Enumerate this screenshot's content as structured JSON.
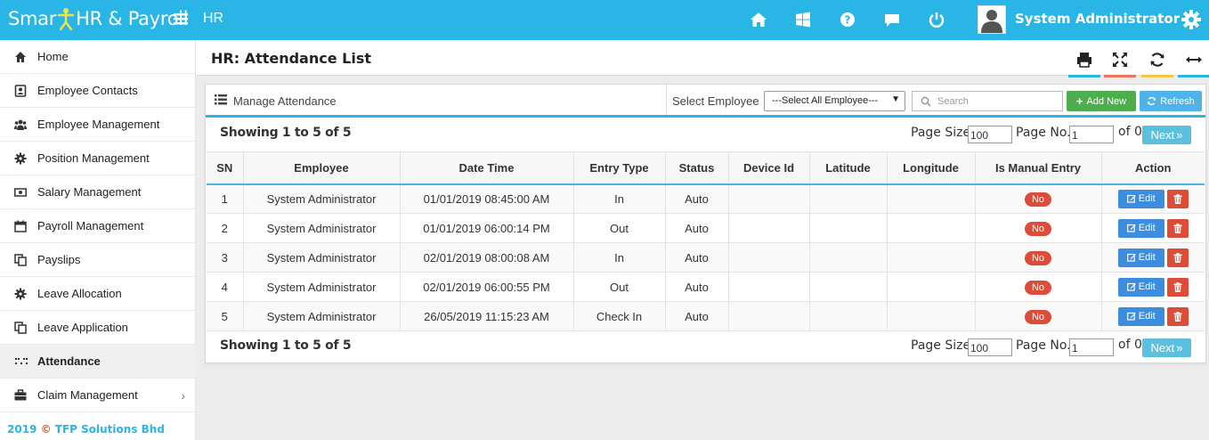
{
  "app": {
    "logo_left": "Smar",
    "logo_right": "HR & Payroll",
    "module": "HR",
    "user_name": "System Administrator",
    "brand_color": "#29b6e6",
    "top_icons": [
      "home-icon",
      "windows-icon",
      "help-icon",
      "chat-icon",
      "power-icon"
    ]
  },
  "sidebar": {
    "items": [
      {
        "label": "Home",
        "icon": "home-icon"
      },
      {
        "label": "Employee Contacts",
        "icon": "contact-icon"
      },
      {
        "label": "Employee Management",
        "icon": "users-icon"
      },
      {
        "label": "Position Management",
        "icon": "gear-icon"
      },
      {
        "label": "Salary Management",
        "icon": "money-icon"
      },
      {
        "label": "Payroll Management",
        "icon": "calendar-icon"
      },
      {
        "label": "Payslips",
        "icon": "copy-icon"
      },
      {
        "label": "Leave Allocation",
        "icon": "gear-icon"
      },
      {
        "label": "Leave Application",
        "icon": "copy-icon"
      },
      {
        "label": "Attendance",
        "icon": "fingerprint-icon"
      },
      {
        "label": "Claim Management",
        "icon": "briefcase-icon"
      }
    ],
    "footer_year": "2019",
    "footer_company": "TFP Solutions Bhd"
  },
  "page": {
    "title": "HR: Attendance List",
    "tools": [
      "print-icon",
      "fullscreen-icon",
      "refresh-icon",
      "expand-icon"
    ]
  },
  "panel": {
    "title": "Manage Attendance",
    "select_label": "Select Employee",
    "select_value": "---Select All Employee---",
    "search_placeholder": "Search",
    "add_label": "Add New",
    "refresh_label": "Refresh"
  },
  "pager": {
    "showing": "Showing 1 to 5 of 5",
    "page_size_label": "Page Size",
    "page_size": "100",
    "page_no_label": "Page No.",
    "page_no": "1",
    "of_label": "of 0",
    "next_label": "Next"
  },
  "table": {
    "columns": [
      "SN",
      "Employee",
      "Date Time",
      "Entry Type",
      "Status",
      "Device Id",
      "Latitude",
      "Longitude",
      "Is Manual Entry",
      "Action"
    ],
    "edit_label": "Edit",
    "rows": [
      {
        "sn": "1",
        "employee": "System Administrator",
        "datetime": "01/01/2019 08:45:00 AM",
        "entry": "In",
        "status": "Auto",
        "device": "",
        "lat": "",
        "lng": "",
        "manual": "No"
      },
      {
        "sn": "2",
        "employee": "System Administrator",
        "datetime": "01/01/2019 06:00:14 PM",
        "entry": "Out",
        "status": "Auto",
        "device": "",
        "lat": "",
        "lng": "",
        "manual": "No"
      },
      {
        "sn": "3",
        "employee": "System Administrator",
        "datetime": "02/01/2019 08:00:08 AM",
        "entry": "In",
        "status": "Auto",
        "device": "",
        "lat": "",
        "lng": "",
        "manual": "No"
      },
      {
        "sn": "4",
        "employee": "System Administrator",
        "datetime": "02/01/2019 06:00:55 PM",
        "entry": "Out",
        "status": "Auto",
        "device": "",
        "lat": "",
        "lng": "",
        "manual": "No"
      },
      {
        "sn": "5",
        "employee": "System Administrator",
        "datetime": "26/05/2019 11:15:23 AM",
        "entry": "Check In",
        "status": "Auto",
        "device": "",
        "lat": "",
        "lng": "",
        "manual": "No"
      }
    ]
  }
}
